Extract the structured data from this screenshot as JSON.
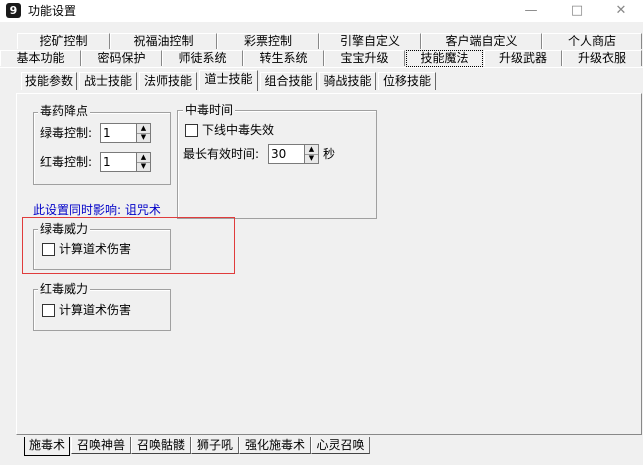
{
  "window": {
    "title": "功能设置",
    "app_icon_glyph": "9",
    "minimize_glyph": "—",
    "maximize_glyph": "□",
    "close_glyph": "✕"
  },
  "top_tabs_row1": [
    "挖矿控制",
    "祝福油控制",
    "彩票控制",
    "引擎自定义",
    "客户端自定义",
    "个人商店"
  ],
  "top_tabs_row2": [
    "基本功能",
    "密码保护",
    "师徒系统",
    "转生系统",
    "宝宝升级",
    "技能魔法",
    "升级武器",
    "升级衣服"
  ],
  "top_tabs_row2_selected": 5,
  "sub_tabs": [
    "技能参数",
    "战士技能",
    "法师技能",
    "道士技能",
    "组合技能",
    "骑战技能",
    "位移技能"
  ],
  "sub_tabs_selected": 3,
  "poison_group": {
    "title": "毒药降点",
    "green_label": "绿毒控制:",
    "green_value": "1",
    "red_label": "红毒控制:",
    "red_value": "1"
  },
  "poison_time_group": {
    "title": "中毒时间",
    "offline_label": "下线中毒失效",
    "offline_checked": false,
    "max_time_label": "最长有效时间:",
    "max_time_value": "30",
    "unit": "秒"
  },
  "note": "此设置同时影响: 诅咒术",
  "green_power_group": {
    "title": "绿毒威力",
    "calc_label": "计算道术伤害",
    "calc_checked": false
  },
  "red_power_group": {
    "title": "红毒威力",
    "calc_label": "计算道术伤害",
    "calc_checked": false
  },
  "bottom_tabs": [
    "施毒术",
    "召唤神兽",
    "召唤骷髅",
    "狮子吼",
    "强化施毒术",
    "心灵召唤"
  ],
  "bottom_tabs_selected": 0,
  "colors": {
    "highlight": "#e03c3c",
    "note_text": "#0000c8"
  }
}
